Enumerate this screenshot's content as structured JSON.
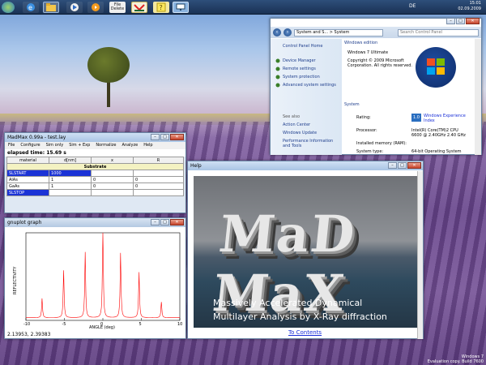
{
  "taskbar": {
    "file_label": "File Delete",
    "tray_lang": "DE",
    "clock_time": "15:01",
    "clock_date": "02.09.2009"
  },
  "madmax": {
    "title": "MadMax 0.99a - test.lay",
    "menu": [
      "File",
      "Configure",
      "Sim only",
      "Sim + Exp",
      "Normalize",
      "Analyze",
      "Help"
    ],
    "elapsed": "elapsed time: 15.69 s",
    "columns": [
      "material",
      "d[nm]",
      "x",
      "R"
    ],
    "substrate": "Substrate",
    "rows": [
      {
        "name": "SLSTART",
        "d": "1000",
        "x": "",
        "r": ""
      },
      {
        "name": "AlAs",
        "d": "1",
        "x": "0",
        "r": "0"
      },
      {
        "name": "GaAs",
        "d": "1",
        "x": "0",
        "r": "0"
      },
      {
        "name": "SLSTOP",
        "d": "",
        "x": "",
        "r": ""
      }
    ]
  },
  "gnuplot": {
    "title": "gnuplot graph",
    "status": "2.13953, 2.39383"
  },
  "chart_data": {
    "type": "line",
    "title": "",
    "xlabel": "ANGLE (deg)",
    "ylabel": "REFLECTIVITY",
    "xlim": [
      -10,
      10
    ],
    "ylim": [
      0,
      1
    ],
    "x_ticks": [
      "-10",
      "-5",
      "0",
      "5",
      "10"
    ],
    "y_ticks": [],
    "grid": false,
    "series": [
      {
        "color": "#ff0000",
        "peaks": [
          {
            "x": -7.9,
            "y": 0.22
          },
          {
            "x": -5.1,
            "y": 0.54
          },
          {
            "x": -2.3,
            "y": 0.75
          },
          {
            "x": 0.0,
            "y": 1.0
          },
          {
            "x": 2.3,
            "y": 0.74
          },
          {
            "x": 4.7,
            "y": 0.52
          },
          {
            "x": 7.6,
            "y": 0.18
          }
        ],
        "baseline": 0.03
      }
    ]
  },
  "help": {
    "title": "Help",
    "logo_text": "MaD MaX",
    "line1": "Massively Accelerated Dynamical",
    "line2": "Multilayer Analysis by X-Ray diffraction",
    "link": "To Contents"
  },
  "control_panel": {
    "address": "System and S... > System",
    "search_placeholder": "Search Control Panel",
    "home": "Control Panel Home",
    "links": [
      "Device Manager",
      "Remote settings",
      "System protection",
      "Advanced system settings"
    ],
    "see_also": "See also",
    "see_also_links": [
      "Action Center",
      "Windows Update",
      "Performance Information and Tools"
    ],
    "edition_header": "Windows edition",
    "edition": "Windows 7 Ultimate",
    "copyright": "Copyright © 2009 Microsoft Corporation. All rights reserved.",
    "system_header": "System",
    "rating_label": "Rating:",
    "rating_value": "Windows Experience Index",
    "processor_label": "Processor:",
    "processor_value": "Intel(R) Core(TM)2 CPU 6600 @ 2.40GHz 2.40 GHz",
    "memory_label": "Installed memory (RAM):",
    "memory_value": "",
    "systype_label": "System type:",
    "systype_value": "64-bit Operating System",
    "rating_score": "1.0"
  },
  "watermark": {
    "line1": "Windows 7",
    "line2": "Evaluation copy. Build 7600"
  },
  "colors": {
    "selection": "#1b33d6",
    "plot_line": "#ff0000",
    "link": "#1a2fd8"
  }
}
